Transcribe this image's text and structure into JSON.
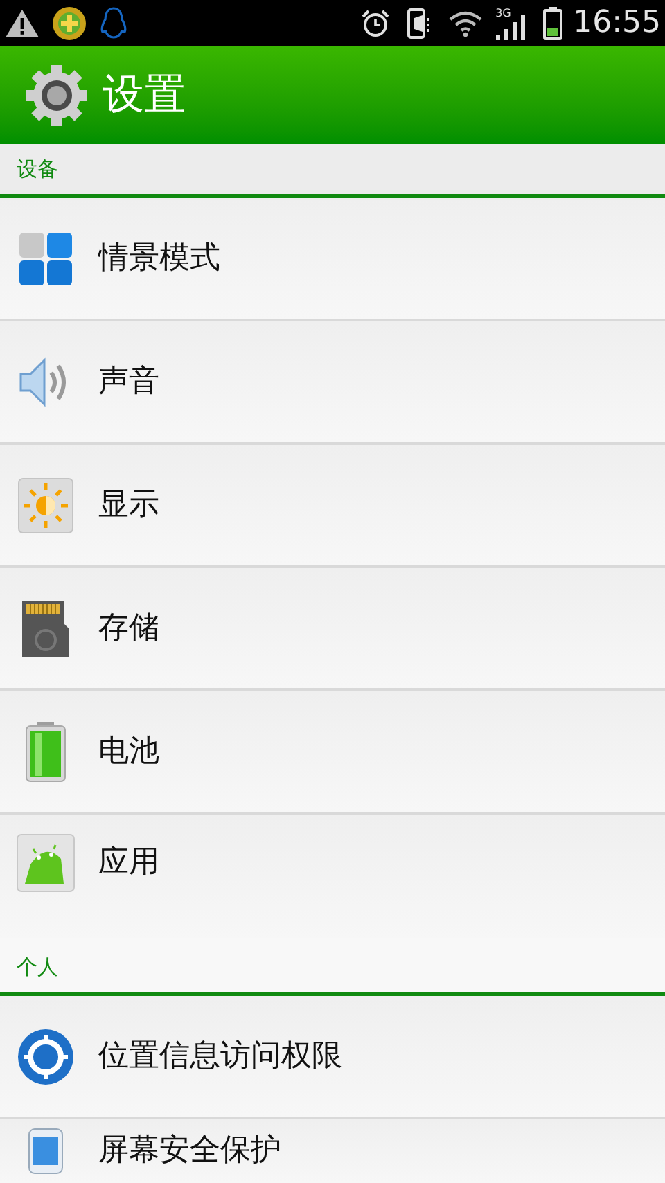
{
  "status_bar": {
    "network": "3G",
    "time": "16:55"
  },
  "header": {
    "title": "设置"
  },
  "sections": [
    {
      "title": "设备",
      "items": [
        {
          "label": "情景模式"
        },
        {
          "label": "声音"
        },
        {
          "label": "显示"
        },
        {
          "label": "存储"
        },
        {
          "label": "电池"
        },
        {
          "label": "应用"
        }
      ]
    },
    {
      "title": "个人",
      "items": [
        {
          "label": "位置信息访问权限"
        },
        {
          "label": "屏幕安全保护"
        }
      ]
    }
  ]
}
